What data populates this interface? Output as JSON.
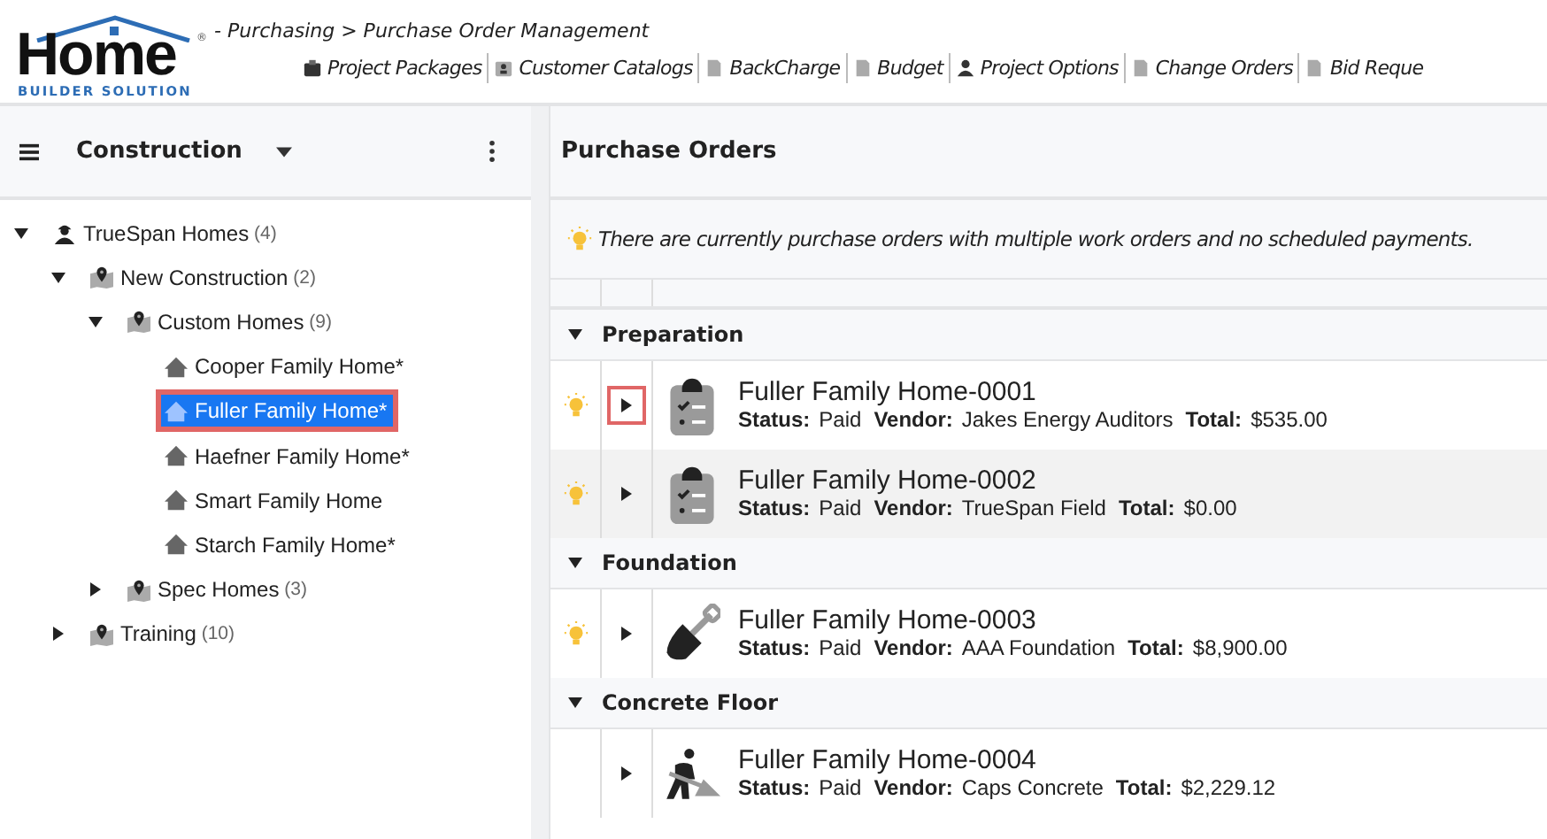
{
  "logo": {
    "word": "Home",
    "tagline": "BUILDER SOLUTION",
    "mark": "®"
  },
  "breadcrumb": "- Purchasing > Purchase Order Management",
  "toolbar": [
    {
      "label": "Project Packages",
      "kind": "box"
    },
    {
      "label": "Customer Catalogs",
      "kind": "badge"
    },
    {
      "label": "BackCharge",
      "kind": "doc"
    },
    {
      "label": "Budget",
      "kind": "doc"
    },
    {
      "label": "Project Options",
      "kind": "person"
    },
    {
      "label": "Change Orders",
      "kind": "doc"
    },
    {
      "label": "Bid Reque",
      "kind": "doc"
    }
  ],
  "sidebar": {
    "title": "Construction",
    "tree": [
      {
        "label": "TrueSpan Homes",
        "count": "(4)",
        "kind": "company",
        "expanded": true,
        "selected": false,
        "outlined": false,
        "children": [
          {
            "label": "New Construction",
            "count": "(2)",
            "kind": "region",
            "expanded": true,
            "selected": false,
            "outlined": false,
            "children": [
              {
                "label": "Custom Homes",
                "count": "(9)",
                "kind": "region",
                "expanded": true,
                "selected": false,
                "outlined": false,
                "children": [
                  {
                    "label": "Cooper Family Home*",
                    "kind": "home",
                    "selected": false,
                    "outlined": false
                  },
                  {
                    "label": "Fuller Family Home*",
                    "kind": "home",
                    "selected": true,
                    "outlined": true
                  },
                  {
                    "label": "Haefner Family Home*",
                    "kind": "home",
                    "selected": false,
                    "outlined": false
                  },
                  {
                    "label": "Smart Family Home",
                    "kind": "home",
                    "selected": false,
                    "outlined": false
                  },
                  {
                    "label": "Starch Family Home*",
                    "kind": "home",
                    "selected": false,
                    "outlined": false
                  }
                ]
              },
              {
                "label": "Spec Homes",
                "count": "(3)",
                "kind": "region",
                "expanded": false,
                "selected": false,
                "outlined": false
              }
            ]
          },
          {
            "label": "Training",
            "count": "(10)",
            "kind": "region",
            "expanded": false,
            "selected": false,
            "outlined": false
          }
        ]
      }
    ]
  },
  "main": {
    "title": "Purchase Orders",
    "notice": "There are currently purchase orders with multiple work orders and no scheduled payments.",
    "groups": [
      {
        "name": "Preparation",
        "expanded": true,
        "orders": [
          {
            "title": "Fuller Family Home-0001",
            "kind": "clipboard",
            "alert": true,
            "outlined": true,
            "hover": false,
            "fields": [
              {
                "label": "Status:",
                "value": "Paid"
              },
              {
                "label": "Vendor:",
                "value": "Jakes Energy Auditors"
              },
              {
                "label": "Total:",
                "value": "$535.00"
              }
            ]
          },
          {
            "title": "Fuller Family Home-0002",
            "kind": "clipboard",
            "alert": true,
            "outlined": false,
            "hover": true,
            "fields": [
              {
                "label": "Status:",
                "value": "Paid"
              },
              {
                "label": "Vendor:",
                "value": "TrueSpan Field"
              },
              {
                "label": "Total:",
                "value": "$0.00"
              }
            ]
          }
        ]
      },
      {
        "name": "Foundation",
        "expanded": true,
        "orders": [
          {
            "title": "Fuller Family Home-0003",
            "kind": "shovel",
            "alert": true,
            "outlined": false,
            "hover": false,
            "fields": [
              {
                "label": "Status:",
                "value": "Paid"
              },
              {
                "label": "Vendor:",
                "value": "AAA Foundation"
              },
              {
                "label": "Total:",
                "value": "$8,900.00"
              }
            ]
          }
        ]
      },
      {
        "name": "Concrete Floor",
        "expanded": true,
        "orders": [
          {
            "title": "Fuller Family Home-0004",
            "kind": "worker",
            "alert": false,
            "outlined": false,
            "hover": false,
            "fields": [
              {
                "label": "Status:",
                "value": "Paid"
              },
              {
                "label": "Vendor:",
                "value": "Caps Concrete"
              },
              {
                "label": "Total:",
                "value": "$2,229.12"
              }
            ]
          }
        ]
      }
    ]
  }
}
